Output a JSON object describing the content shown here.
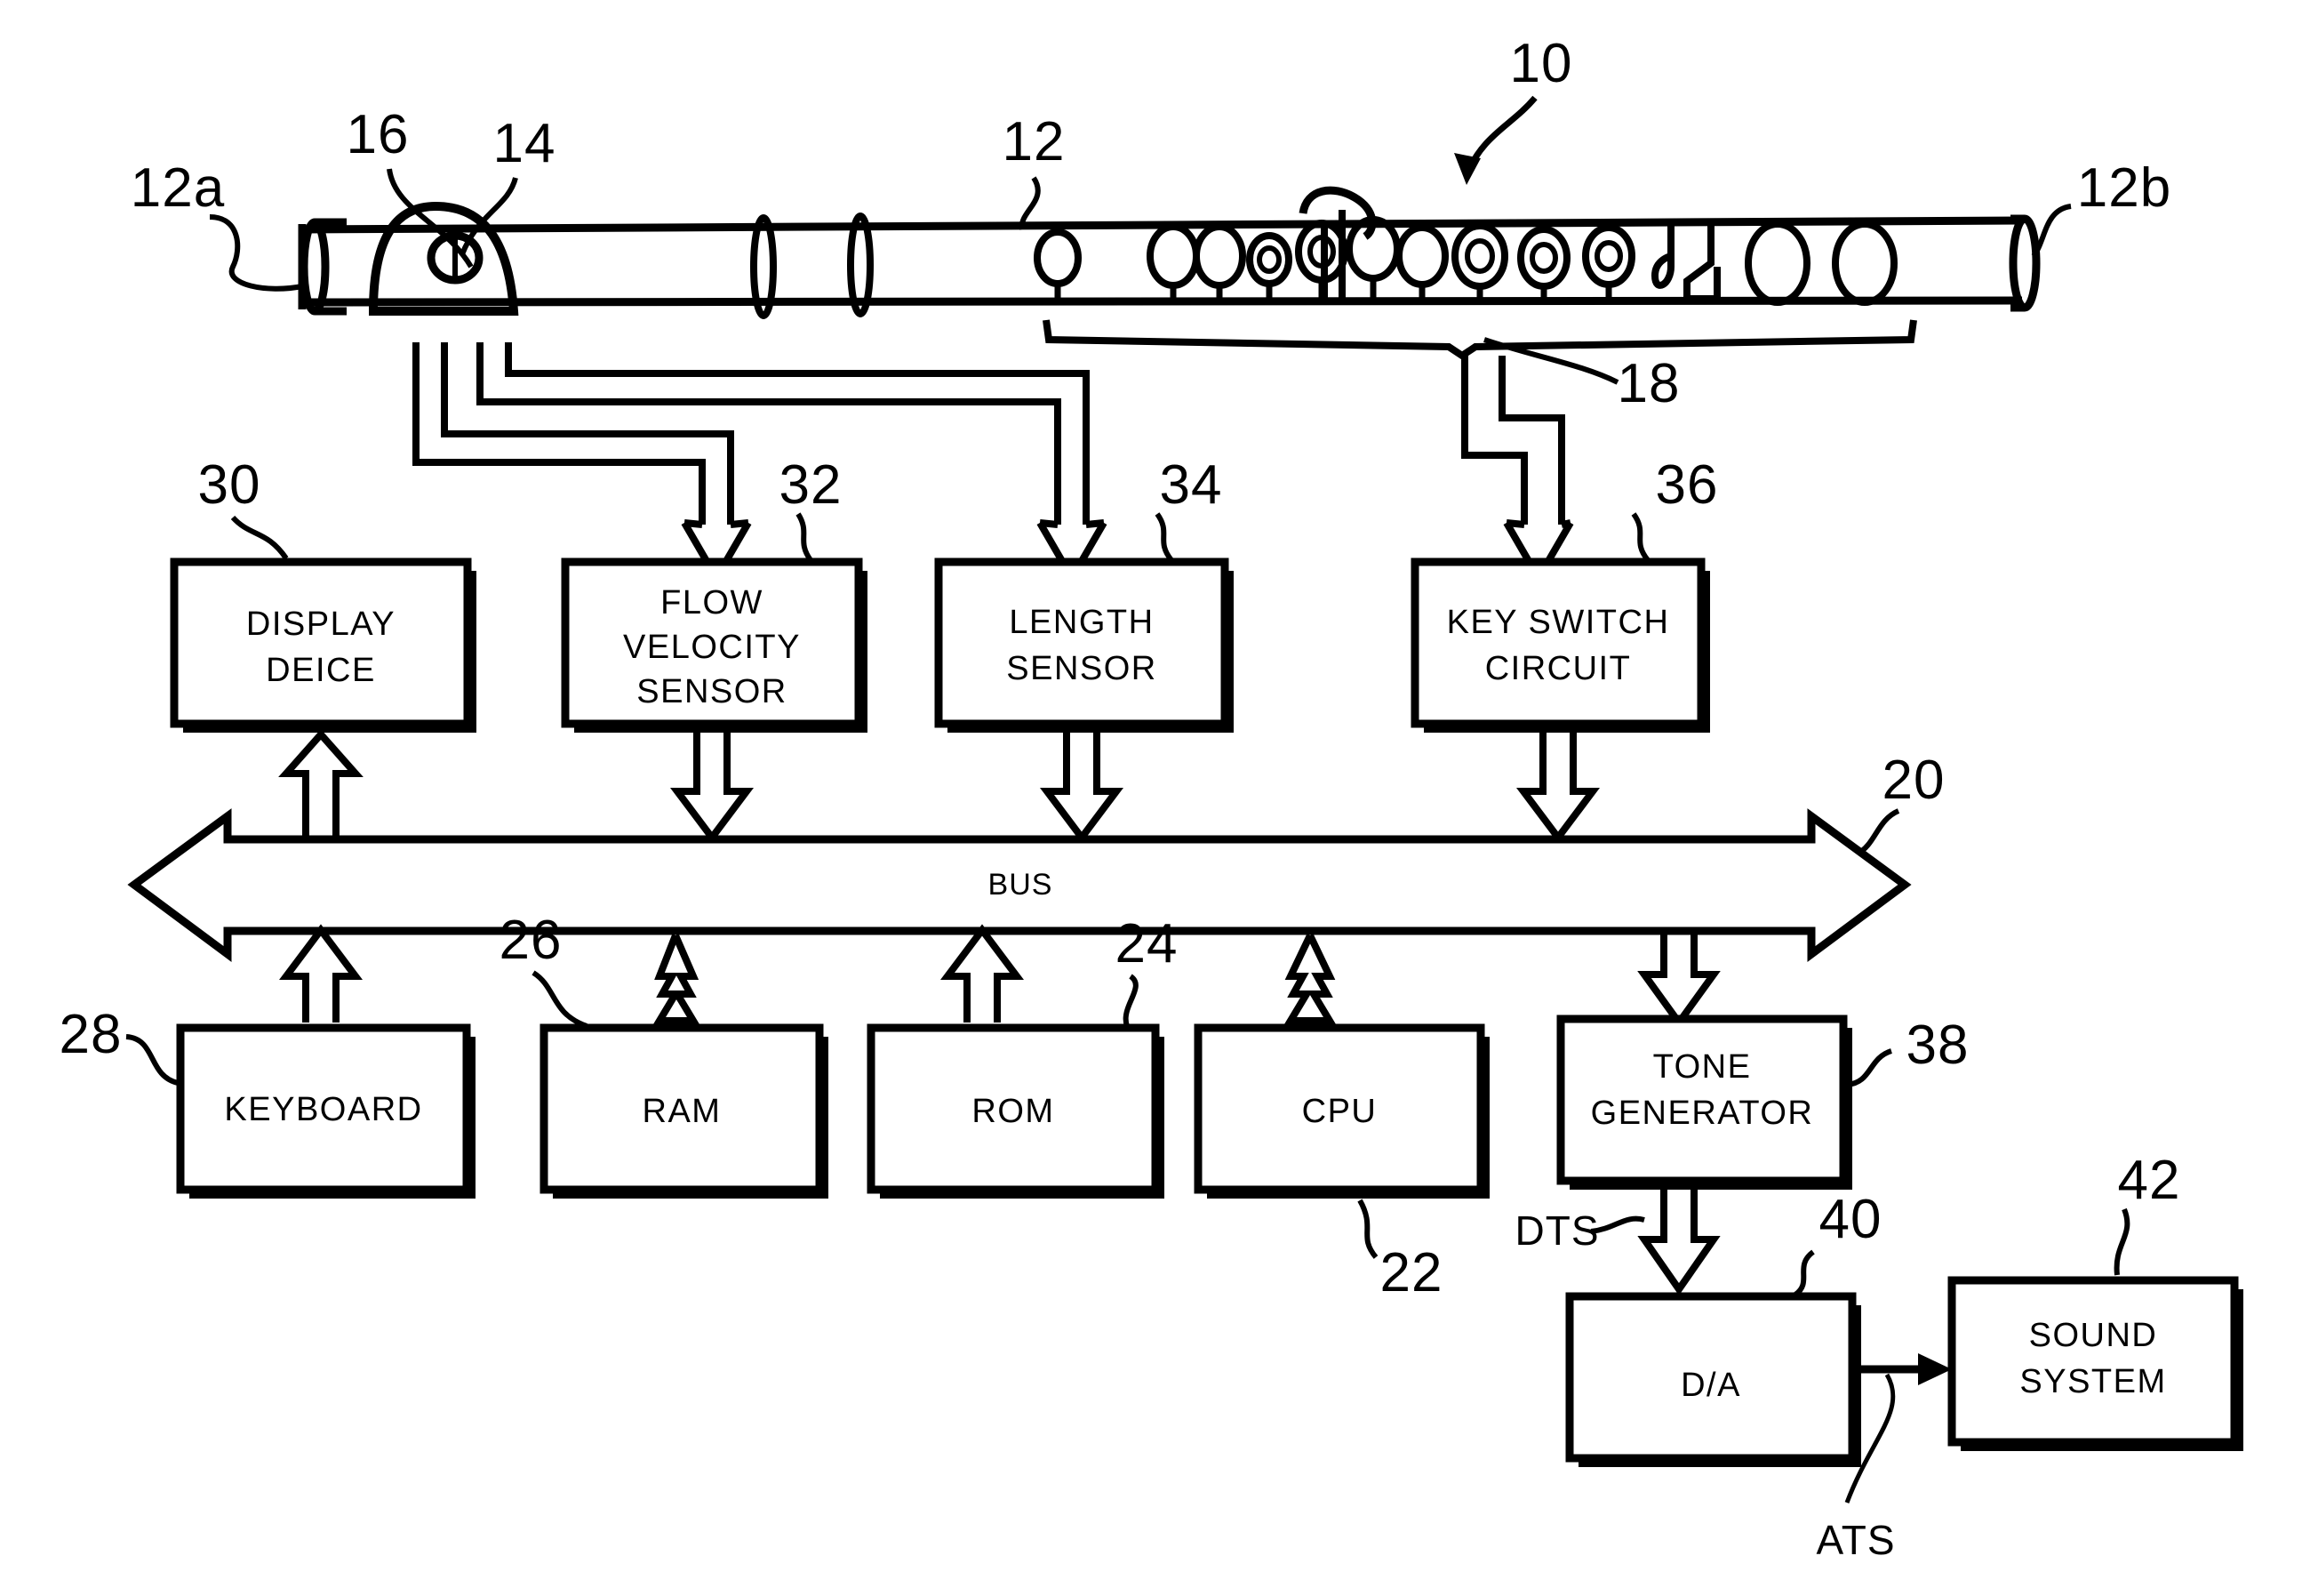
{
  "figure": {
    "title_ref": "10",
    "type": "patent-block-diagram"
  },
  "instrument": {
    "name": "flute",
    "body_ref": "12",
    "head_end_ref": "12a",
    "foot_end_ref": "12b",
    "system_ref": "10",
    "mouthpiece_ref": "16",
    "embouchure_hole_ref": "14",
    "keys_group_ref": "18"
  },
  "blocks": [
    {
      "id": "display",
      "ref": "30",
      "lines": [
        "DISPLAY",
        "DEICE"
      ]
    },
    {
      "id": "flow",
      "ref": "32",
      "lines": [
        "FLOW",
        "VELOCITY",
        "SENSOR"
      ]
    },
    {
      "id": "length",
      "ref": "34",
      "lines": [
        "LENGTH",
        "SENSOR"
      ]
    },
    {
      "id": "keyswitch",
      "ref": "36",
      "lines": [
        "KEY SWITCH",
        "CIRCUIT"
      ]
    },
    {
      "id": "keyboard",
      "ref": "28",
      "lines": [
        "KEYBOARD"
      ]
    },
    {
      "id": "ram",
      "ref": "26",
      "lines": [
        "RAM"
      ]
    },
    {
      "id": "rom",
      "ref": "24",
      "lines": [
        "ROM"
      ]
    },
    {
      "id": "cpu",
      "ref": "22",
      "lines": [
        "CPU"
      ]
    },
    {
      "id": "tonegen",
      "ref": "38",
      "lines": [
        "TONE",
        "GENERATOR"
      ]
    },
    {
      "id": "da",
      "ref": "40",
      "lines": [
        "D/A"
      ]
    },
    {
      "id": "sound",
      "ref": "42",
      "lines": [
        "SOUND",
        "SYSTEM"
      ]
    }
  ],
  "bus": {
    "label": "BUS",
    "ref": "20"
  },
  "signals": [
    {
      "id": "dts",
      "label": "DTS"
    },
    {
      "id": "ats",
      "label": "ATS"
    }
  ],
  "refs": {
    "r10": "10",
    "r12": "12",
    "r12a": "12a",
    "r12b": "12b",
    "r14": "14",
    "r16": "16",
    "r18": "18",
    "r20": "20",
    "r22": "22",
    "r24": "24",
    "r26": "26",
    "r28": "28",
    "r30": "30",
    "r32": "32",
    "r34": "34",
    "r36": "36",
    "r38": "38",
    "r40": "40",
    "r42": "42"
  },
  "colors": {
    "ink": "#000000",
    "paper": "#ffffff"
  }
}
